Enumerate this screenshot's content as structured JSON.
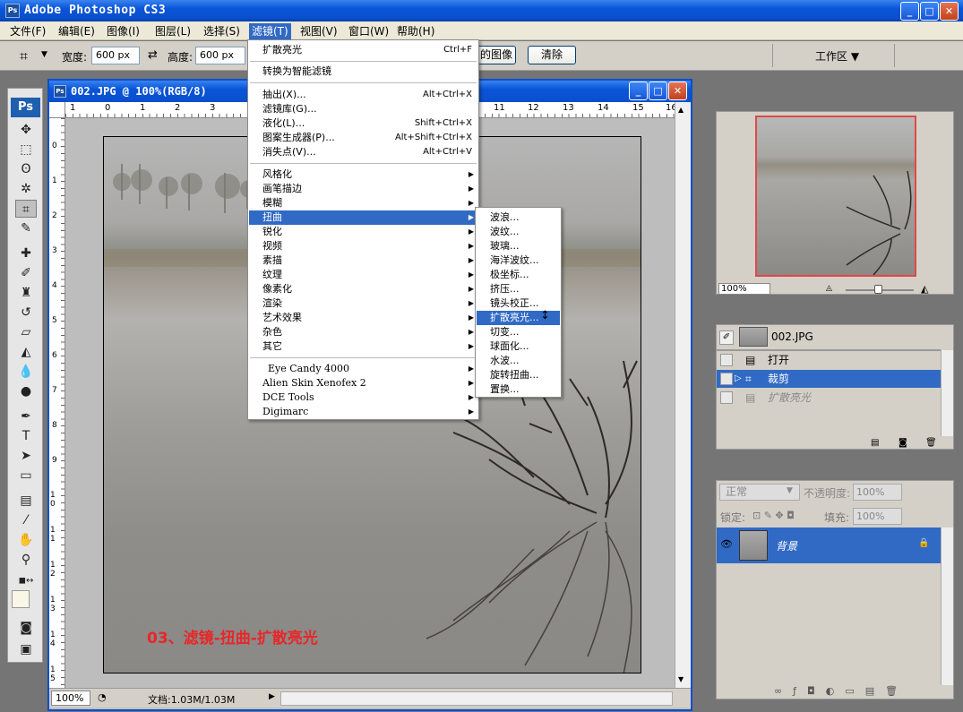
{
  "app": {
    "title": "Adobe Photoshop CS3",
    "icon_text": "Ps"
  },
  "menubar": [
    {
      "label": "文件(F)"
    },
    {
      "label": "编辑(E)"
    },
    {
      "label": "图像(I)"
    },
    {
      "label": "图层(L)"
    },
    {
      "label": "选择(S)"
    },
    {
      "label": "滤镜(T)"
    },
    {
      "label": "视图(V)"
    },
    {
      "label": "窗口(W)"
    },
    {
      "label": "帮助(H)"
    }
  ],
  "options": {
    "width_label": "宽度:",
    "width_value": "600 px",
    "height_label": "高度:",
    "height_value": "600 px",
    "front_image_btn": "的图像",
    "clear_btn": "清除",
    "workspace_btn": "工作区 ▼"
  },
  "document": {
    "title": "002.JPG @ 100%(RGB/8)",
    "ruler_h": [
      "1",
      "0",
      "1",
      "2",
      "3",
      "11",
      "12",
      "13",
      "14",
      "15",
      "16"
    ],
    "ruler_v": [
      "0",
      "1",
      "2",
      "3",
      "4",
      "5",
      "6",
      "7",
      "8",
      "9",
      "10",
      "11",
      "12",
      "13",
      "14",
      "15"
    ],
    "caption": "03、滤镜-扭曲-扩散亮光",
    "status_zoom": "100%",
    "status_doc": "文档:1.03M/1.03M"
  },
  "filter_menu": {
    "last_filter": {
      "label": "扩散亮光",
      "shortcut": "Ctrl+F"
    },
    "convert_smart": "转换为智能滤镜",
    "group1": [
      {
        "label": "抽出(X)...",
        "shortcut": "Alt+Ctrl+X"
      },
      {
        "label": "滤镜库(G)...",
        "shortcut": ""
      },
      {
        "label": "液化(L)...",
        "shortcut": "Shift+Ctrl+X"
      },
      {
        "label": "图案生成器(P)...",
        "shortcut": "Alt+Shift+Ctrl+X"
      },
      {
        "label": "消失点(V)...",
        "shortcut": "Alt+Ctrl+V"
      }
    ],
    "group2": [
      "风格化",
      "画笔描边",
      "模糊",
      "扭曲",
      "锐化",
      "视频",
      "素描",
      "纹理",
      "像素化",
      "渲染",
      "艺术效果",
      "杂色",
      "其它"
    ],
    "group3": [
      "Eye Candy 4000",
      "Alien Skin Xenofex 2",
      "DCE Tools",
      "Digimarc"
    ]
  },
  "distort_submenu": [
    "波浪...",
    "波纹...",
    "玻璃...",
    "海洋波纹...",
    "极坐标...",
    "挤压...",
    "镜头校正...",
    "扩散亮光...",
    "切变...",
    "球面化...",
    "水波...",
    "旋转扭曲...",
    "置换..."
  ],
  "navigator": {
    "zoom": "100%"
  },
  "history": {
    "snapshot": "002.JPG",
    "items": [
      "打开",
      "裁剪",
      "扩散亮光"
    ]
  },
  "layers": {
    "blend_mode": "正常",
    "opacity_label": "不透明度:",
    "opacity_value": "100%",
    "lock_label": "锁定:",
    "fill_label": "填充:",
    "fill_value": "100%",
    "layer_name": "背景"
  },
  "colors": {
    "accent": "#316ac5",
    "titlebar": "#0a55d8",
    "caption": "#e8262a"
  }
}
